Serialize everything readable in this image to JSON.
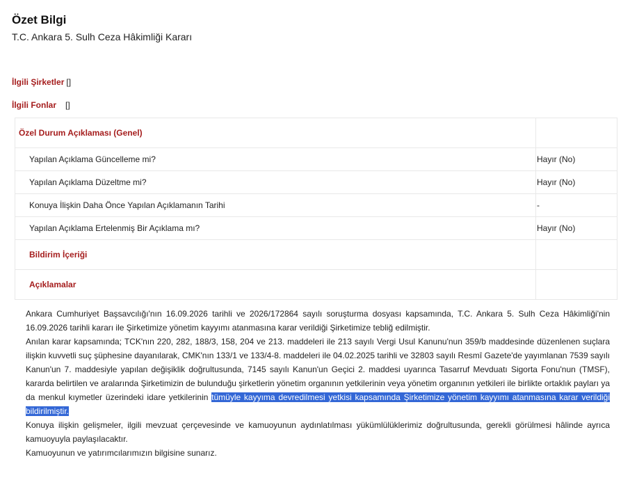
{
  "header": {
    "title": "Özet Bilgi",
    "subtitle": "T.C. Ankara 5. Sulh Ceza Hâkimliği Kararı"
  },
  "related": {
    "companies_label": "İlgili Şirketler",
    "companies_value": "[]",
    "funds_label": "İlgili Fonlar",
    "funds_value": "[]"
  },
  "table": {
    "section_title": "Özel Durum Açıklaması (Genel)",
    "rows": [
      {
        "question": "Yapılan Açıklama Güncelleme mi?",
        "answer": "Hayır (No)"
      },
      {
        "question": "Yapılan Açıklama Düzeltme mi?",
        "answer": "Hayır (No)"
      },
      {
        "question": "Konuya İlişkin Daha Önce Yapılan Açıklamanın Tarihi",
        "answer": "-"
      },
      {
        "question": "Yapılan Açıklama Ertelenmiş Bir Açıklama mı?",
        "answer": "Hayır (No)"
      }
    ],
    "notification_content_label": "Bildirim İçeriği",
    "explanations_label": "Açıklamalar"
  },
  "body": {
    "p1": "Ankara Cumhuriyet Başsavcılığı'nın 16.09.2026 tarihli ve 2026/172864 sayılı soruşturma dosyası kapsamında, T.C. Ankara 5. Sulh Ceza Hâkimliği'nin 16.09.2026 tarihli kararı ile Şirketimize yönetim kayyımı atanmasına karar verildiği Şirketimize tebliğ edilmiştir.",
    "p2_before": "Anılan karar kapsamında; TCK'nın 220, 282, 188/3, 158, 204 ve 213. maddeleri ile 213 sayılı Vergi Usul Kanunu'nun 359/b maddesinde düzenlenen suçlara ilişkin kuvvetli suç şüphesine dayanılarak, CMK'nın 133/1 ve 133/4-8. maddeleri ile 04.02.2025 tarihli ve 32803 sayılı Resmî Gazete'de yayımlanan 7539 sayılı Kanun'un 7. maddesiyle yapılan değişiklik doğrultusunda, 7145 sayılı Kanun'un Geçici 2. maddesi uyarınca Tasarruf Mevduatı Sigorta Fonu'nun (TMSF), kararda belirtilen ve aralarında Şirketimizin de bulunduğu şirketlerin yönetim organının yetkilerinin veya yönetim organının yetkileri ile birlikte ortaklık payları ya da menkul kıymetler üzerindeki idare yetkilerinin",
    "p2_highlight": "tümüyle kayyıma devredilmesi yetkisi kapsamında Şirketimize yönetim kayyımı atanmasına karar verildiği bildirilmiştir.",
    "p3": "Konuya ilişkin gelişmeler, ilgili mevzuat çerçevesinde ve kamuoyunun aydınlatılması yükümlülüklerimiz doğrultusunda, gerekli görülmesi hâlinde ayrıca kamuoyuyla paylaşılacaktır.",
    "p4": "Kamuoyunun ve yatırımcılarımızın bilgisine sunarız."
  },
  "colors": {
    "label_red": "#a51d1d",
    "highlight_blue": "#3367d6",
    "border": "#e8e8e8"
  }
}
